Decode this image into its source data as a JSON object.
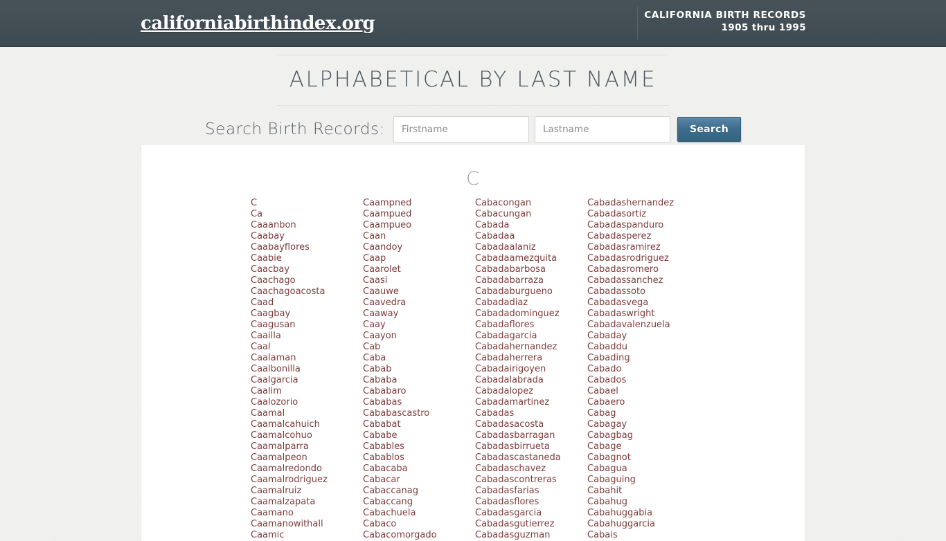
{
  "header": {
    "brand": "californiabirthindex.org",
    "records_title": "CALIFORNIA BIRTH RECORDS",
    "records_range": "1905 thru 1995"
  },
  "page": {
    "title": "ALPHABETICAL BY LAST NAME",
    "letter_heading": "C"
  },
  "search": {
    "label": "Search Birth Records:",
    "firstname_placeholder": "Firstname",
    "firstname_value": "",
    "lastname_placeholder": "Lastname",
    "lastname_value": "",
    "button_label": "Search"
  },
  "colors": {
    "header_bg": "#414f57",
    "link": "#7d3b3b",
    "button": "#3d6d8d",
    "page_bg": "#f0f0ef",
    "title_text": "#4a555c"
  },
  "columns": [
    {
      "names": [
        "C",
        "Ca",
        "Caaanbon",
        "Caabay",
        "Caabayflores",
        "Caabie",
        "Caacbay",
        "Caachago",
        "Caachagoacosta",
        "Caad",
        "Caagbay",
        "Caagusan",
        "Caailla",
        "Caal",
        "Caalaman",
        "Caalbonilla",
        "Caalgarcia",
        "Caalim",
        "Caalozorio",
        "Caamal",
        "Caamalcahuich",
        "Caamalcohuo",
        "Caamalparra",
        "Caamalpeon",
        "Caamalredondo",
        "Caamalrodriguez",
        "Caamalruiz",
        "Caamalzapata",
        "Caamano",
        "Caamanowithall",
        "Caamic"
      ]
    },
    {
      "names": [
        "Caampned",
        "Caampued",
        "Caampueo",
        "Caan",
        "Caandoy",
        "Caap",
        "Caarolet",
        "Caasi",
        "Caauwe",
        "Caavedra",
        "Caaway",
        "Caay",
        "Caayon",
        "Cab",
        "Caba",
        "Cabab",
        "Cababa",
        "Cababaro",
        "Cababas",
        "Cababascastro",
        "Cababat",
        "Cababe",
        "Cabables",
        "Cabablos",
        "Cabacaba",
        "Cabacar",
        "Cabaccanag",
        "Cabaccang",
        "Cabachuela",
        "Cabaco",
        "Cabacomorgado"
      ]
    },
    {
      "names": [
        "Cabacongan",
        "Cabacungan",
        "Cabada",
        "Cabadaa",
        "Cabadaalaniz",
        "Cabadaamezquita",
        "Cabadabarbosa",
        "Cabadabarraza",
        "Cabadaburgueno",
        "Cabadadiaz",
        "Cabadadominguez",
        "Cabadaflores",
        "Cabadagarcia",
        "Cabadahernandez",
        "Cabadaherrera",
        "Cabadairigoyen",
        "Cabadalabrada",
        "Cabadalopez",
        "Cabadamartinez",
        "Cabadas",
        "Cabadasacosta",
        "Cabadasbarragan",
        "Cabadasbirrueta",
        "Cabadascastaneda",
        "Cabadaschavez",
        "Cabadascontreras",
        "Cabadasfarias",
        "Cabadasflores",
        "Cabadasgarcia",
        "Cabadasgutierrez",
        "Cabadasguzman"
      ]
    },
    {
      "names": [
        "Cabadashernandez",
        "Cabadasortiz",
        "Cabadaspanduro",
        "Cabadasperez",
        "Cabadasramirez",
        "Cabadasrodriguez",
        "Cabadasromero",
        "Cabadassanchez",
        "Cabadassoto",
        "Cabadasvega",
        "Cabadaswright",
        "Cabadavalenzuela",
        "Cabaday",
        "Cabaddu",
        "Cabading",
        "Cabado",
        "Cabados",
        "Cabael",
        "Cabaero",
        "Cabag",
        "Cabagay",
        "Cabagbag",
        "Cabage",
        "Cabagnot",
        "Cabagua",
        "Cabaguing",
        "Cabahit",
        "Cabahug",
        "Cabahuggabia",
        "Cabahuggarcia",
        "Cabais"
      ]
    }
  ]
}
